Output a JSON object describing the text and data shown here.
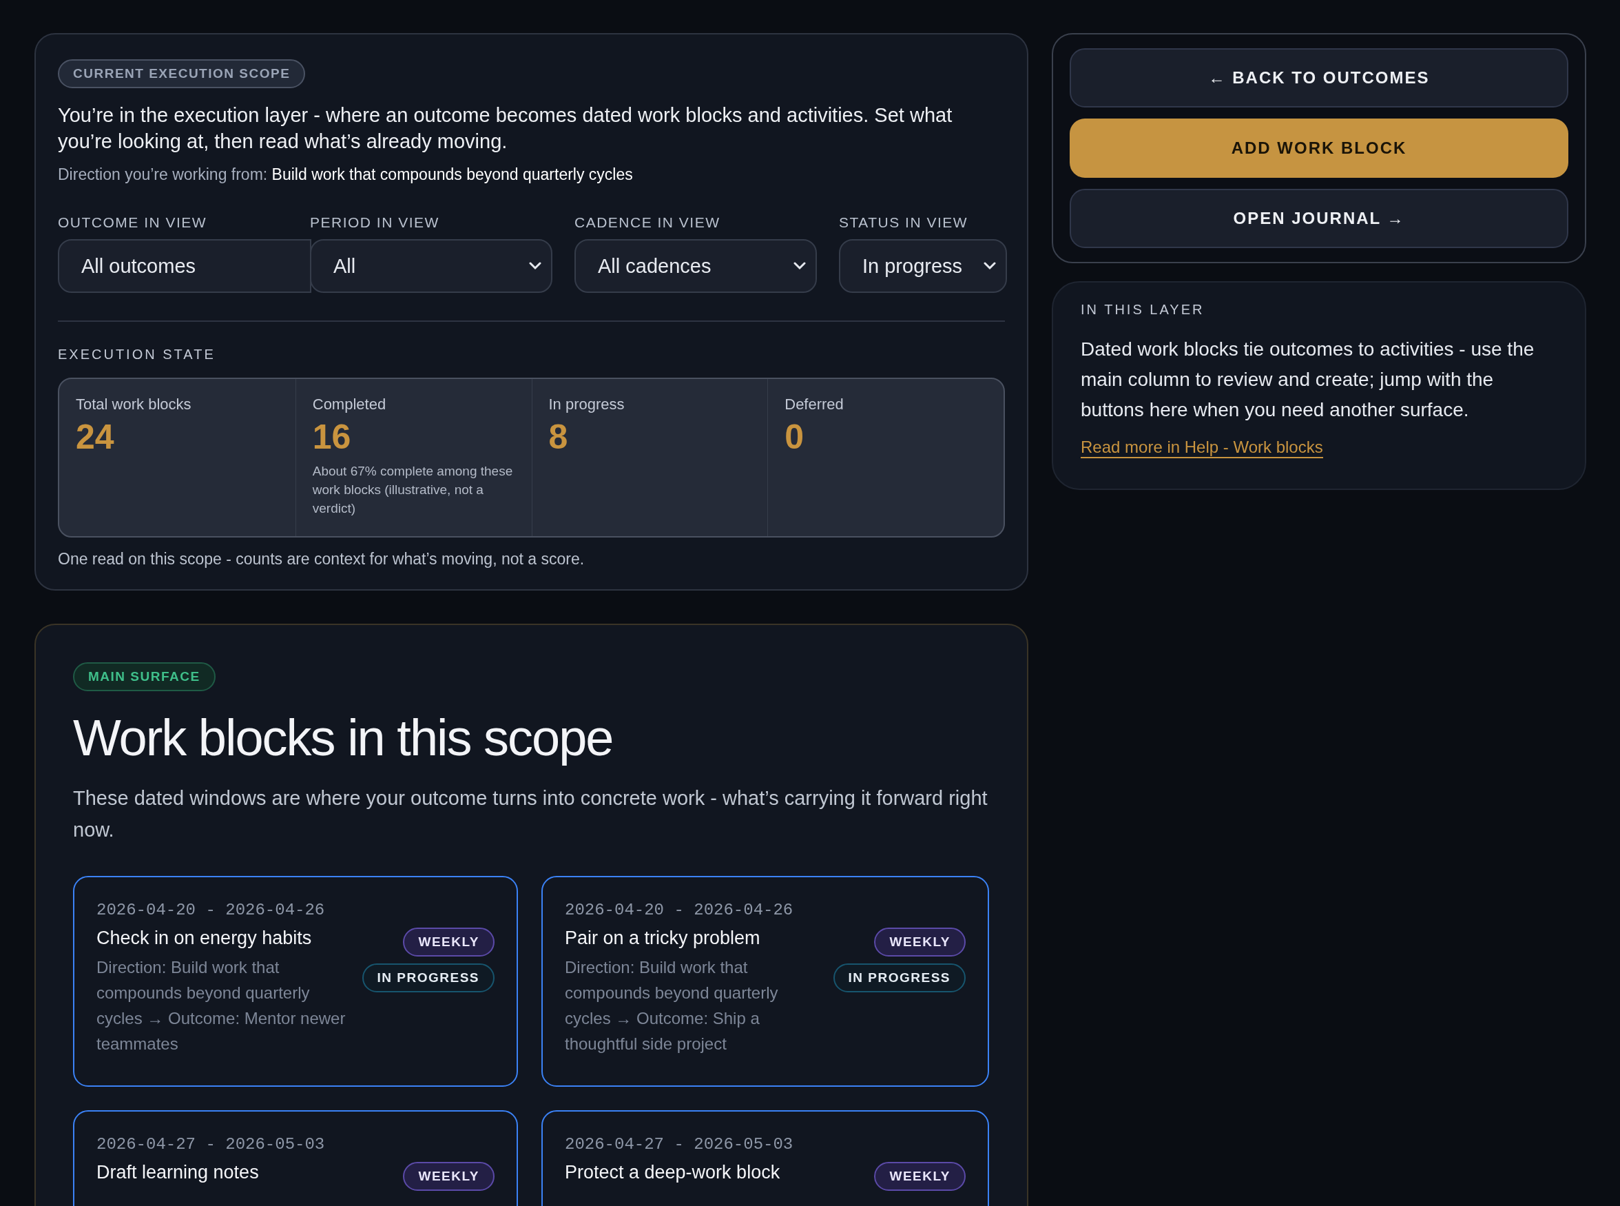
{
  "scope": {
    "badge": "CURRENT EXECUTION SCOPE",
    "intro": "You’re in the execution layer - where an outcome becomes dated work blocks and activities. Set what you’re looking at, then read what’s already moving.",
    "direction_label": "Direction you’re working from:",
    "direction_value": "Build work that compounds beyond quarterly cycles",
    "filters": [
      {
        "label": "OUTCOME IN VIEW",
        "value": "All outcomes",
        "dropdown": false
      },
      {
        "label": "PERIOD IN VIEW",
        "value": "All",
        "dropdown": true
      },
      {
        "label": "CADENCE IN VIEW",
        "value": "All cadences",
        "dropdown": true
      },
      {
        "label": "STATUS IN VIEW",
        "value": "In progress",
        "dropdown": true
      }
    ],
    "state_heading": "EXECUTION STATE",
    "stats": [
      {
        "label": "Total work blocks",
        "value": "24"
      },
      {
        "label": "Completed",
        "value": "16",
        "note": "About 67% complete among these work blocks (illustrative, not a verdict)"
      },
      {
        "label": "In progress",
        "value": "8"
      },
      {
        "label": "Deferred",
        "value": "0"
      }
    ],
    "footnote": "One read on this scope - counts are context for what’s moving, not a score."
  },
  "main": {
    "badge": "MAIN SURFACE",
    "title": "Work blocks in this scope",
    "description": "These dated windows are where your outcome turns into concrete work - what’s carrying it forward right now.",
    "cards": [
      {
        "dates": "2026-04-20 - 2026-04-26",
        "title": "Check in on energy habits",
        "path": "Direction: Build work that compounds beyond quarterly cycles → Outcome: Mentor newer teammates",
        "cadence": "WEEKLY",
        "status": "IN PROGRESS"
      },
      {
        "dates": "2026-04-20 - 2026-04-26",
        "title": "Pair on a tricky problem",
        "path": "Direction: Build work that compounds beyond quarterly cycles → Outcome: Ship a thoughtful side project",
        "cadence": "WEEKLY",
        "status": "IN PROGRESS"
      },
      {
        "dates": "2026-04-27 - 2026-05-03",
        "title": "Draft learning notes",
        "cadence": "WEEKLY"
      },
      {
        "dates": "2026-04-27 - 2026-05-03",
        "title": "Protect a deep-work block",
        "cadence": "WEEKLY"
      }
    ]
  },
  "actions": [
    {
      "label": "← BACK TO OUTCOMES",
      "kind": "secondary"
    },
    {
      "label": "ADD WORK BLOCK",
      "kind": "primary"
    },
    {
      "label": "OPEN JOURNAL →",
      "kind": "secondary"
    }
  ],
  "info": {
    "heading": "IN THIS LAYER",
    "body": "Dated work blocks tie outcomes to activities - use the main column to review and create; jump with the buttons here when you need another surface.",
    "link": "Read more in Help - Work blocks"
  }
}
